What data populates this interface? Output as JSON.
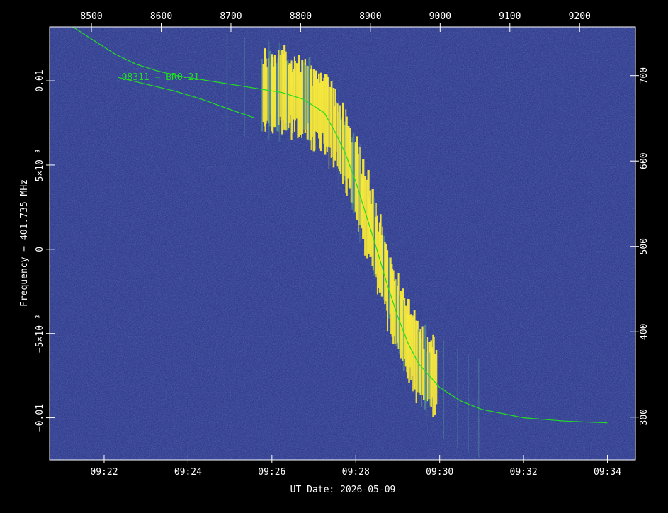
{
  "chart_data": {
    "type": "heatmap",
    "xlabel": "UT Date: 2026-05-09",
    "ylabel": "Frequency − 401.735 MHz",
    "label_color": "#ffffff",
    "background_color": "#2f3b8c",
    "signal_color": "#f6e63a",
    "track_color": "#22dd22",
    "x_bottom": {
      "range": [
        "09:20:42",
        "09:34:40"
      ],
      "ticks": [
        "09:22",
        "09:24",
        "09:26",
        "09:28",
        "09:30",
        "09:32",
        "09:34"
      ],
      "tick_values": [
        "09:22:00",
        "09:24:00",
        "09:26:00",
        "09:28:00",
        "09:30:00",
        "09:32:00",
        "09:34:00"
      ]
    },
    "x_top": {
      "range": [
        8440,
        9280
      ],
      "ticks": [
        "8500",
        "8600",
        "8700",
        "8800",
        "8900",
        "9000",
        "9100",
        "9200"
      ],
      "tick_values": [
        8500,
        8600,
        8700,
        8800,
        8900,
        9000,
        9100,
        9200
      ]
    },
    "y_left": {
      "range": [
        -0.0125,
        0.0132
      ],
      "ticks": [
        "0.01",
        "5×10⁻³",
        "0",
        "−5×10⁻³",
        "−0.01"
      ],
      "tick_values": [
        0.01,
        0.005,
        0,
        -0.005,
        -0.01
      ]
    },
    "y_right": {
      "range": [
        250,
        757
      ],
      "ticks": [
        "700",
        "600",
        "500",
        "400",
        "300"
      ],
      "tick_values": [
        700,
        600,
        500,
        400,
        300
      ]
    },
    "annotations": [
      {
        "text": "98311 − BRO-21",
        "x": "09:22:25",
        "y": 0.01
      }
    ],
    "series": [
      {
        "points": [
          [
            "09:21:15",
            0.0132
          ],
          [
            "09:21:45",
            0.0124
          ],
          [
            "09:22:15",
            0.0116
          ],
          [
            "09:22:45",
            0.011
          ],
          [
            "09:23:15",
            0.0106
          ],
          [
            "09:23:45",
            0.0103
          ],
          [
            "09:24:15",
            0.0101
          ],
          [
            "09:24:45",
            0.0099
          ],
          [
            "09:25:15",
            0.0097
          ],
          [
            "09:25:45",
            0.0095
          ],
          [
            "09:26:15",
            0.0093
          ],
          [
            "09:26:45",
            0.0089
          ],
          [
            "09:27:15",
            0.0081
          ],
          [
            "09:27:30",
            0.007
          ],
          [
            "09:27:45",
            0.0057
          ],
          [
            "09:28:00",
            0.004
          ],
          [
            "09:28:15",
            0.002
          ],
          [
            "09:28:30",
            0.0
          ],
          [
            "09:28:45",
            -0.0021
          ],
          [
            "09:29:00",
            -0.004
          ],
          [
            "09:29:15",
            -0.0056
          ],
          [
            "09:29:30",
            -0.0068
          ],
          [
            "09:30:00",
            -0.0082
          ],
          [
            "09:30:30",
            -0.009
          ],
          [
            "09:31:00",
            -0.0095
          ],
          [
            "09:32:00",
            -0.01
          ],
          [
            "09:33:00",
            -0.0102
          ],
          [
            "09:34:00",
            -0.0103
          ]
        ]
      },
      {
        "points": [
          [
            "09:22:20",
            0.0102
          ],
          [
            "09:23:00",
            0.0098
          ],
          [
            "09:23:40",
            0.0094
          ],
          [
            "09:24:20",
            0.0089
          ],
          [
            "09:25:00",
            0.0083
          ],
          [
            "09:25:35",
            0.0078
          ]
        ]
      }
    ]
  }
}
